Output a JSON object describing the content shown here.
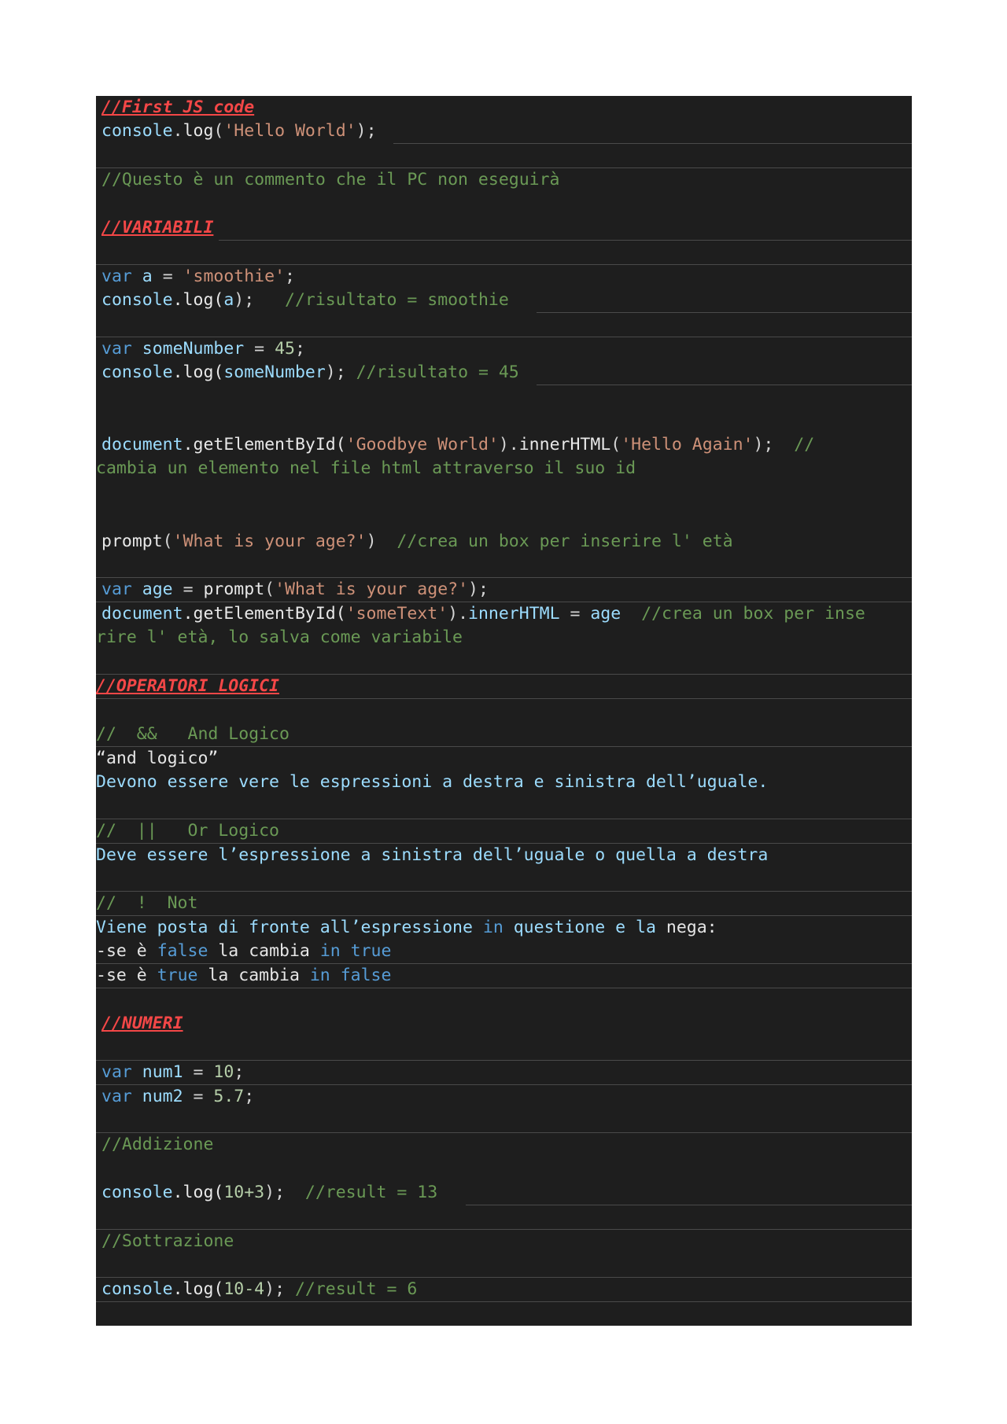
{
  "sections": {
    "first_code_header": "//First JS code",
    "variables_header": "//VARIABILI",
    "logic_header": "//OPERATORI LOGICI",
    "numbers_header": "//NUMERI"
  },
  "lines": {
    "l1_obj": "console",
    "l1_dot": ".",
    "l1_fn": "log",
    "l1_open": "(",
    "l1_str": "'Hello World'",
    "l1_close": ");",
    "comment_questo": "//Questo è un commento che il PC non eseguirà",
    "l2_kw": "var",
    "l2_var": " a ",
    "l2_eq": "= ",
    "l2_str": "'smoothie'",
    "l2_semi": ";",
    "l3_obj": "console",
    "l3_rest": ".log(",
    "l3_arg": "a",
    "l3_close": ");   ",
    "l3_com": "//risultato = smoothie",
    "l4_kw": "var",
    "l4_var": " someNumber",
    "l4_eq": " = ",
    "l4_num": "45",
    "l4_semi": ";",
    "l5_obj": "console",
    "l5_rest": ".log(",
    "l5_arg": "someNumber",
    "l5_close": "); ",
    "l5_com": "//risultato = 45",
    "l6_obj": "document",
    "l6_fn": ".getElementById(",
    "l6_str": "'Goodbye World'",
    "l6_mid": ").",
    "l6_prop": "innerHTML",
    "l6_open": "(",
    "l6_str2": "'Hello Again'",
    "l6_close": ");  ",
    "l6_com_a": "//",
    "l6_com_b": "cambia un elemento nel file html attraverso il suo id",
    "l7_fn": "prompt",
    "l7_open": "(",
    "l7_str": "'What is your age?'",
    "l7_close": ")  ",
    "l7_com": "//crea un box per inserire l' età",
    "l8_kw": "var",
    "l8_var": " age",
    "l8_eq": " = ",
    "l8_fn": "prompt",
    "l8_open": "(",
    "l8_str": "'What is your age?'",
    "l8_close": ");",
    "l9_obj": "document",
    "l9_fn": ".getElementById(",
    "l9_str": "'someText'",
    "l9_mid": ").",
    "l9_prop": "innerHTML",
    "l9_eq": " = ",
    "l9_var": "age",
    "l9_sp": "  ",
    "l9_com_a": "//crea un box per inse",
    "l9_com_b": "rire l' età, lo salva come variabile",
    "and_com": "//  &&   And Logico",
    "and_quote": "“and logico”",
    "and_desc": "Devono essere vere le espressioni a destra e sinistra dell’uguale.",
    "or_com": "//  ||   Or Logico",
    "or_desc": "Deve essere l’espressione a sinistra dell’uguale o quella a destra",
    "not_com": "//  !  Not",
    "not_a": "Viene posta di fronte all’espressione ",
    "not_in": "in",
    "not_b": " questione e la ",
    "not_c": "nega:",
    "n1_dash": "-",
    "n1_a": "se è ",
    "n1_false": "false",
    "n1_b": " la cambia ",
    "n1_in": "in",
    "n1_sp": " ",
    "n1_true": "true",
    "n2_dash": "-",
    "n2_a": "se è ",
    "n2_true": "true",
    "n2_b": " la cambia ",
    "n2_in": "in",
    "n2_sp": " ",
    "n2_false": "false",
    "num1_kw": "var",
    "num1_var": " num1",
    "num1_eq": " = ",
    "num1_val": "10",
    "num1_semi": ";",
    "num2_kw": "var",
    "num2_var": " num2",
    "num2_eq": " = ",
    "num2_val": "5.7",
    "num2_semi": ";",
    "add_com": "//Addizione",
    "add_obj": "console",
    "add_rest": ".log(",
    "add_expr": "10+3",
    "add_close": ");  ",
    "add_res": "//result = 13",
    "sub_com": "//Sottrazione",
    "sub_obj": "console",
    "sub_rest": ".log(",
    "sub_expr": "10-4",
    "sub_close": "); ",
    "sub_res": "//result = 6"
  }
}
